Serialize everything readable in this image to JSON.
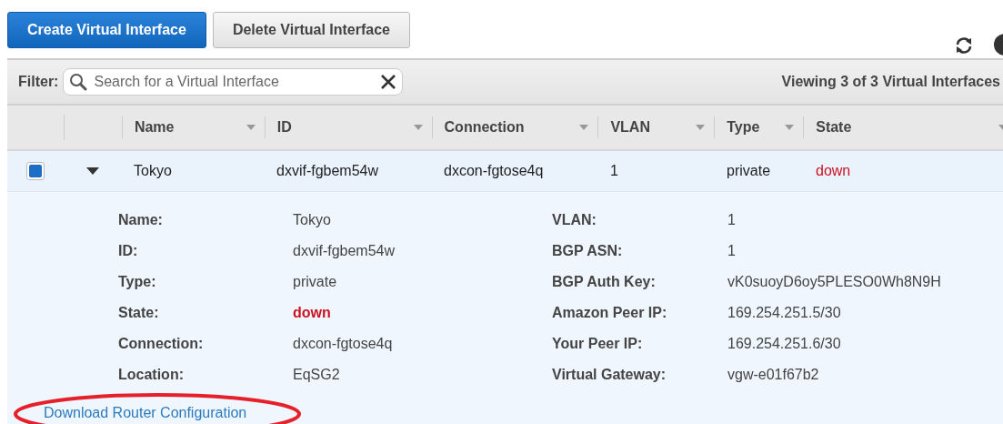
{
  "toolbar": {
    "buttons": [
      {
        "label": "Create Virtual Interface",
        "kind": "primary"
      },
      {
        "label": "Delete Virtual Interface",
        "kind": "secondary"
      }
    ]
  },
  "filter": {
    "label": "Filter:",
    "placeholder": "Search for a Virtual Interface",
    "count": "Viewing 3 of 3 Virtual Interfaces"
  },
  "table": {
    "columns": [
      {
        "label": "Name"
      },
      {
        "label": "ID"
      },
      {
        "label": "Connection"
      },
      {
        "label": "VLAN"
      },
      {
        "label": "Type"
      },
      {
        "label": "State"
      }
    ],
    "rows": [
      {
        "checked": true,
        "expanded": true,
        "cells": [
          {
            "text": "Tokyo",
            "kind": "plain"
          },
          {
            "text": "dxvif-fgbem54w",
            "kind": "plain"
          },
          {
            "text": "dxcon-fgtose4q",
            "kind": "plain"
          },
          {
            "text": "1",
            "kind": "plain"
          },
          {
            "text": "private",
            "kind": "plain"
          },
          {
            "text": "down",
            "kind": "status"
          }
        ],
        "details": {
          "left": [
            {
              "label": "Name:",
              "value": "Tokyo",
              "kind": "plain"
            },
            {
              "label": "ID:",
              "value": "dxvif-fgbem54w",
              "kind": "plain"
            },
            {
              "label": "Type:",
              "value": "private",
              "kind": "plain"
            },
            {
              "label": "State:",
              "value": "down",
              "kind": "status"
            },
            {
              "label": "Connection:",
              "value": "dxcon-fgtose4q",
              "kind": "plain"
            },
            {
              "label": "Location:",
              "value": "EqSG2",
              "kind": "plain"
            }
          ],
          "right": [
            {
              "label": "VLAN:",
              "value": "1"
            },
            {
              "label": "BGP ASN:",
              "value": "1"
            },
            {
              "label": "BGP Auth Key:",
              "value": "vK0suoyD6oy5PLESO0Wh8N9H"
            },
            {
              "label": "Amazon Peer IP:",
              "value": "169.254.251.5/30"
            },
            {
              "label": "Your Peer IP:",
              "value": "169.254.251.6/30"
            },
            {
              "label": "Virtual Gateway:",
              "value": "vgw-e01f67b2"
            }
          ],
          "link": "Download Router Configuration"
        }
      }
    ]
  }
}
